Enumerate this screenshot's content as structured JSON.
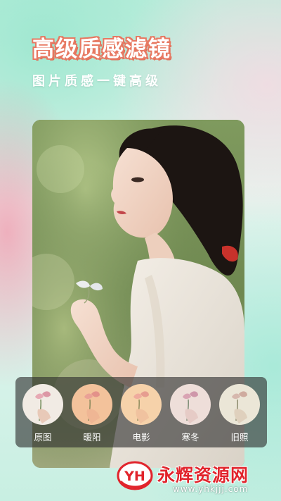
{
  "promo": {
    "title": "高级质感滤镜",
    "subtitle": "图片质感一键高级"
  },
  "filters": [
    {
      "label": "原图",
      "tint": "#f3ede6"
    },
    {
      "label": "暖阳",
      "tint": "#f4c6a0"
    },
    {
      "label": "电影",
      "tint": "#f6d3ad"
    },
    {
      "label": "寒冬",
      "tint": "#efdfe4"
    },
    {
      "label": "旧照",
      "tint": "#ece8da"
    }
  ],
  "watermark": {
    "logo_text": "YH",
    "name": "永辉资源网",
    "url": "www.yhkjjj.com"
  },
  "colors": {
    "headline_stroke": "#e77962",
    "watermark_red": "#e1242c"
  }
}
